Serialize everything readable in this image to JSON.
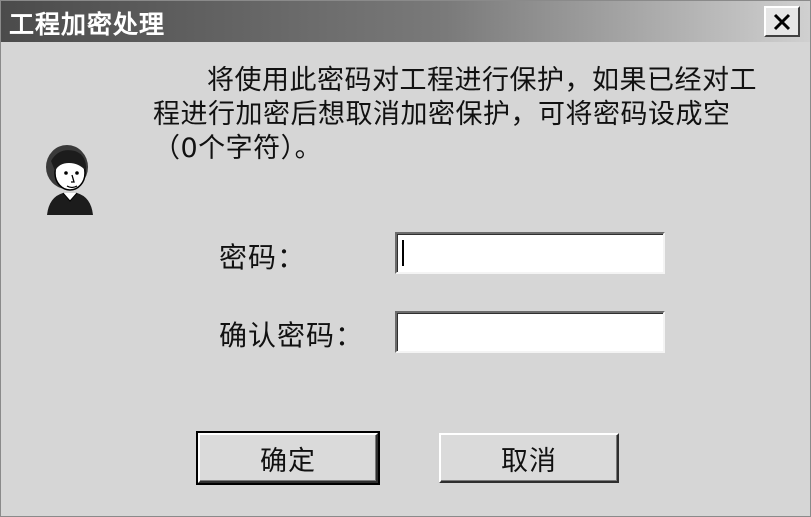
{
  "window": {
    "title": "工程加密处理",
    "close_icon": "close-icon"
  },
  "message": "将使用此密码对工程进行保护，如果已经对工程进行加密后想取消加密保护，可将密码设成空（0个字符）。",
  "avatar_icon": "person-portrait-icon",
  "form": {
    "password_label": "密码：",
    "password_value": "",
    "confirm_label": "确认密码：",
    "confirm_value": ""
  },
  "buttons": {
    "ok_label": "确定",
    "cancel_label": "取消"
  }
}
